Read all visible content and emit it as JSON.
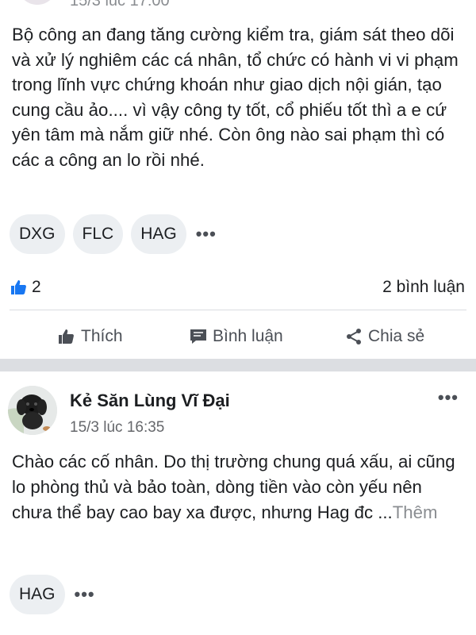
{
  "post1": {
    "meta_partial": "15/3 lúc 17:00",
    "body": "Bộ công an đang tăng cường kiểm tra, giám sát theo dõi và xử lý nghiêm các cá nhân, tổ chức có hành vi vi phạm trong lĩnh vực chứng khoán như giao dịch nội gián, tạo cung cầu ảo.... vì vậy công ty tốt, cổ phiếu tốt thì a e cứ yên tâm mà nắm giữ nhé. Còn ông nào sai phạm thì có các a công an lo rồi nhé.",
    "tags": [
      "DXG",
      "FLC",
      "HAG"
    ],
    "more": "•••",
    "likes_count": "2",
    "comments_count": "2 bình luận",
    "actions": {
      "like": "Thích",
      "comment": "Bình luận",
      "share": "Chia sẻ"
    }
  },
  "post2": {
    "author": "Kẻ Săn Lùng Vĩ Đại",
    "timestamp": "15/3 lúc 16:35",
    "menu": "•••",
    "body": "Chào các cố nhân. Do thị trường chung quá xấu, ai cũng lo phòng thủ và bảo toàn, dòng tiền vào còn yếu nên chưa thể bay cao bay xa được, nhưng Hag đc ...",
    "see_more": "Thêm",
    "tags": [
      "HAG"
    ],
    "more": "•••"
  },
  "colors": {
    "like_blue": "#1877f2",
    "muted_text": "#65676b",
    "chip_bg": "#eceff2",
    "separator": "#dcdee2"
  },
  "icons": {
    "like": "thumbs-up-icon",
    "comment": "comment-icon",
    "share": "share-icon",
    "more": "more-dots-icon"
  }
}
